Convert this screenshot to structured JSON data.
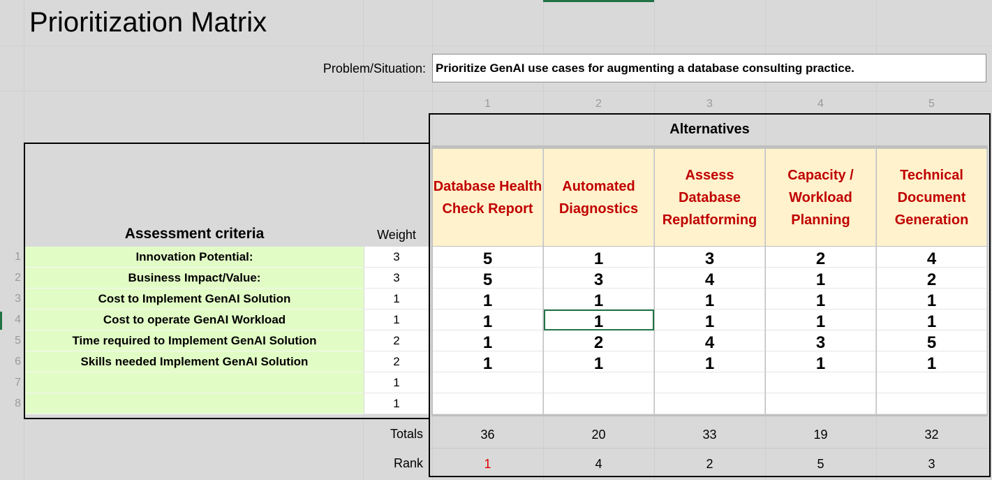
{
  "title": "Prioritization Matrix",
  "problem": {
    "label": "Problem/Situation:",
    "text": "Prioritize GenAI use cases for augmenting a database consulting practice."
  },
  "alternatives_header": "Alternatives",
  "column_numbers": [
    "1",
    "2",
    "3",
    "4",
    "5"
  ],
  "alternatives": [
    "Database Health Check Report",
    "Automated Diagnostics",
    "Assess Database Replatforming",
    "Capacity / Workload Planning",
    "Technical Document Generation"
  ],
  "criteria_header": "Assessment criteria",
  "weight_header": "Weight",
  "row_numbers": [
    "1",
    "2",
    "3",
    "4",
    "5",
    "6",
    "7",
    "8"
  ],
  "criteria": [
    "Innovation Potential:",
    "Business Impact/Value:",
    "Cost to Implement GenAI Solution",
    "Cost to operate GenAI Workload",
    "Time required to Implement GenAI Solution",
    "Skills needed Implement GenAI Solution",
    "",
    ""
  ],
  "weights": [
    "3",
    "3",
    "1",
    "1",
    "2",
    "2",
    "1",
    "1"
  ],
  "scores": [
    [
      "5",
      "1",
      "3",
      "2",
      "4"
    ],
    [
      "5",
      "3",
      "4",
      "1",
      "2"
    ],
    [
      "1",
      "1",
      "1",
      "1",
      "1"
    ],
    [
      "1",
      "1",
      "1",
      "1",
      "1"
    ],
    [
      "1",
      "2",
      "4",
      "3",
      "5"
    ],
    [
      "1",
      "1",
      "1",
      "1",
      "1"
    ],
    [
      "",
      "",
      "",
      "",
      ""
    ],
    [
      "",
      "",
      "",
      "",
      ""
    ]
  ],
  "totals_label": "Totals",
  "rank_label": "Rank",
  "totals": [
    "36",
    "20",
    "33",
    "19",
    "32"
  ],
  "ranks": [
    "1",
    "4",
    "2",
    "5",
    "3"
  ],
  "colors": {
    "alt_header_fill": "#fff2cc",
    "alt_header_text": "#c00000",
    "criteria_fill": "#e2fcc6",
    "rank_highlight": "#e00000",
    "selection": "#217346"
  }
}
